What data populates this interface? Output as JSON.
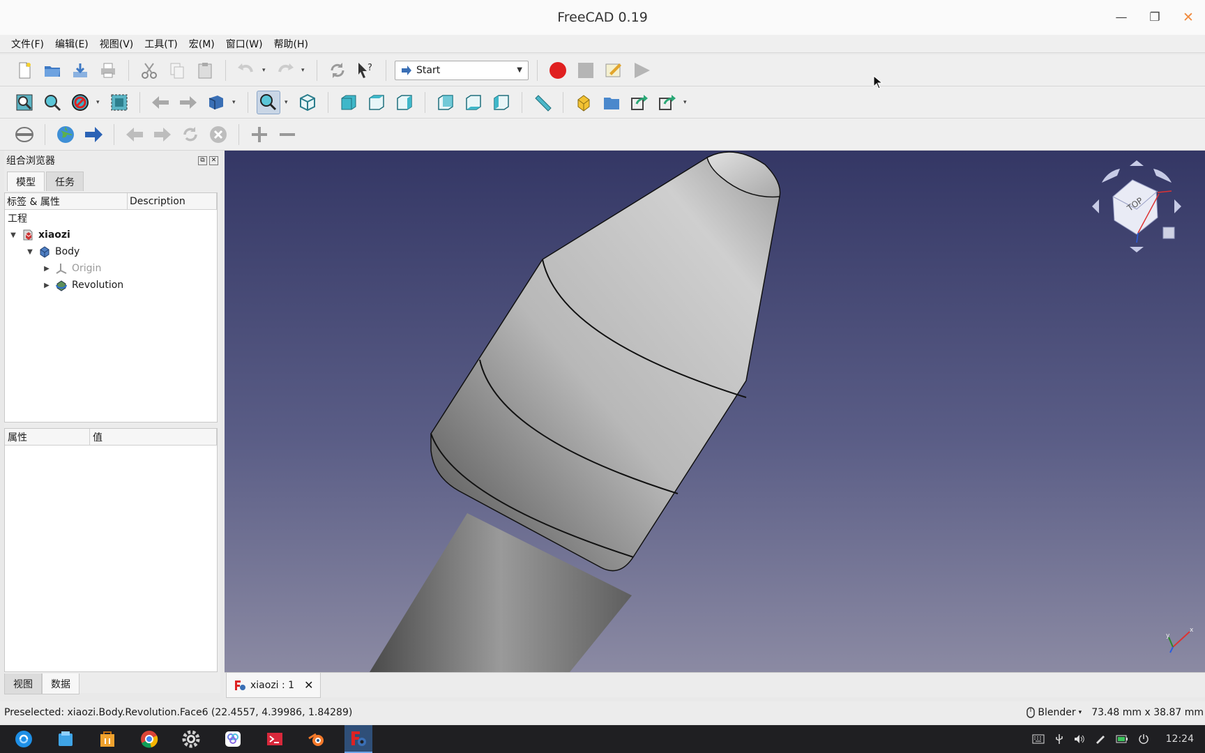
{
  "window": {
    "title": "FreeCAD 0.19"
  },
  "menu": [
    "文件(F)",
    "编辑(E)",
    "视图(V)",
    "工具(T)",
    "宏(M)",
    "窗口(W)",
    "帮助(H)"
  ],
  "workbench": {
    "selected": "Start"
  },
  "combo_view": {
    "title": "组合浏览器",
    "tabs": [
      "模型",
      "任务"
    ],
    "tree_headers": [
      "标签 & 属性",
      "Description"
    ],
    "root_label": "工程",
    "items": [
      {
        "label": "xiaozi",
        "level": 0,
        "expanded": true,
        "bold": true
      },
      {
        "label": "Body",
        "level": 1,
        "expanded": true
      },
      {
        "label": "Origin",
        "level": 2,
        "expanded": false,
        "dimmed": true
      },
      {
        "label": "Revolution",
        "level": 2,
        "expanded": false
      }
    ],
    "property_headers": [
      "属性",
      "值"
    ],
    "bottom_tabs": [
      "视图",
      "数据"
    ]
  },
  "document_tab": {
    "label": "xiaozi : 1"
  },
  "navcube": {
    "face": "TOP"
  },
  "status": {
    "preselected": "Preselected: xiaozi.Body.Revolution.Face6 (22.4557, 4.39986, 1.84289)",
    "nav_style": "Blender",
    "dimensions": "73.48 mm x 38.87 mm"
  },
  "taskbar": {
    "time": "12:24"
  },
  "colors": {
    "viewport_top": "#343765",
    "viewport_bottom": "#8b8aa3",
    "record": "#e02020"
  }
}
